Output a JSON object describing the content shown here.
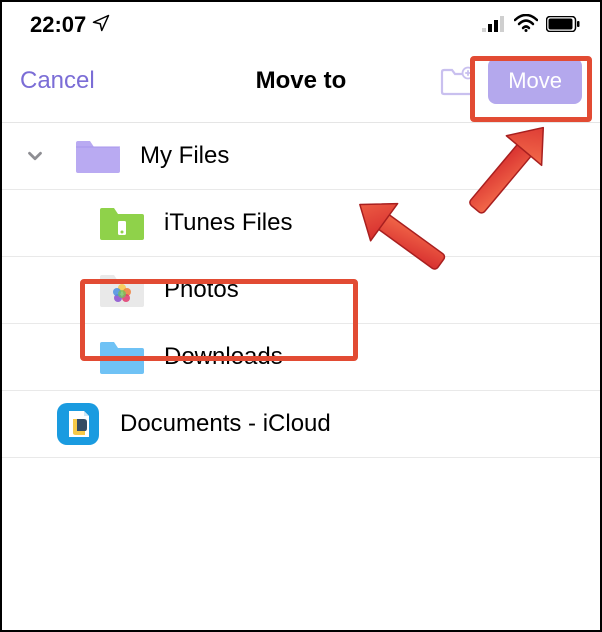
{
  "status_bar": {
    "time": "22:07"
  },
  "nav": {
    "cancel_label": "Cancel",
    "title": "Move to",
    "move_label": "Move"
  },
  "folders": {
    "root": {
      "label": "My Files"
    },
    "itunes": {
      "label": "iTunes Files"
    },
    "photos": {
      "label": "Photos"
    },
    "downloads": {
      "label": "Downloads"
    },
    "icloud": {
      "label": "Documents - iCloud"
    }
  },
  "colors": {
    "accent": "#7b6dd6",
    "move_bg": "#b4a8ed",
    "highlight": "#e24b33"
  }
}
